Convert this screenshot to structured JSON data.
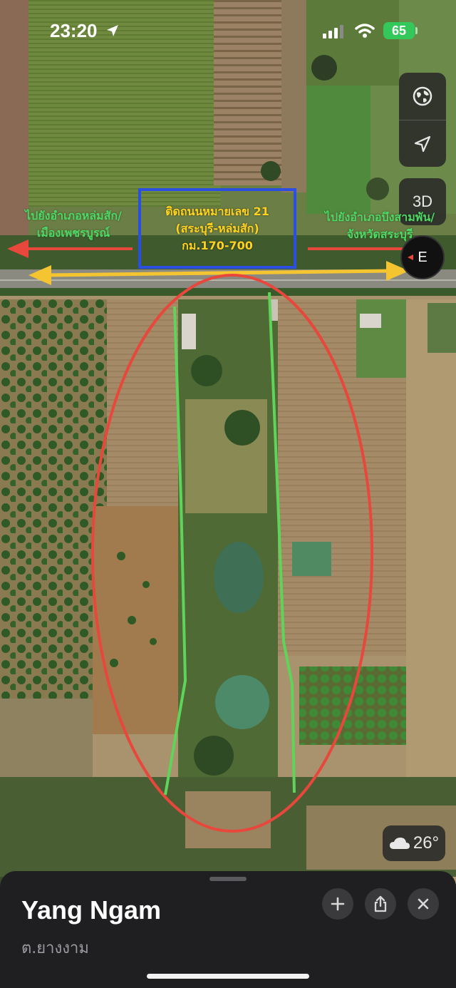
{
  "status_bar": {
    "time": "23:20",
    "battery": "65"
  },
  "map_controls": {
    "globe_icon": "globe-icon",
    "location_icon": "location-arrow-icon",
    "mode_3d_label": "3D",
    "compass_letter": "E"
  },
  "annotations": {
    "left_destination": [
      "ไปยังอำเภอหล่มสัก/",
      "เมืองเพชรบูรณ์"
    ],
    "right_destination": [
      "ไปยังอำเภอบึงสามพัน/",
      "จังหวัดสระบุรี"
    ],
    "road_box": [
      "ติดถนนหมายเลข 21",
      "(สระบุรี-หล่มสัก)",
      "กม.170-700"
    ],
    "colors": {
      "green_text": "#4cd964",
      "yellow_text": "#ffd21f",
      "red_arrow": "#e8473b",
      "yellow_arrow": "#f5c531",
      "blue_box": "#2b4fe0",
      "red_ellipse": "#e8473b",
      "green_boundary": "#5fd35a"
    }
  },
  "weather": {
    "icon": "cloud-icon",
    "temperature": "26°"
  },
  "place_sheet": {
    "title": "Yang Ngam",
    "subtitle": "ต.ยางงาม",
    "add_icon": "plus-icon",
    "share_icon": "share-icon",
    "close_icon": "close-icon"
  }
}
